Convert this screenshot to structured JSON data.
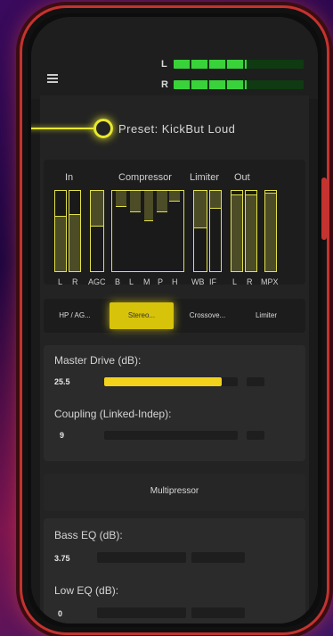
{
  "levels": {
    "left_label": "L",
    "right_label": "R",
    "left_fill": 0.56,
    "right_fill": 0.56
  },
  "preset": {
    "label": "Preset: KickBut  Loud"
  },
  "meters": {
    "group_titles": [
      "In",
      "Compressor",
      "Limiter",
      "Out"
    ],
    "labels": [
      "L",
      "R",
      "AGC",
      "B",
      "L",
      "M",
      "P",
      "H",
      "WB",
      "IF",
      "L",
      "R",
      "MPX"
    ]
  },
  "tabs": [
    {
      "label": "HP / AG..."
    },
    {
      "label": "Stereo..."
    },
    {
      "label": "Crossove..."
    },
    {
      "label": "Limiter"
    }
  ],
  "controls": {
    "master_drive": {
      "label": "Master Drive (dB):",
      "value": "25.5",
      "fill": 0.88
    },
    "coupling": {
      "label": "Coupling (Linked-Indep):",
      "value": "9",
      "fill": 0.0
    }
  },
  "multipressor": {
    "title": "Multipressor",
    "bass_eq": {
      "label": "Bass EQ (dB):",
      "value": "3.75",
      "fill": 0.0
    },
    "low_eq": {
      "label": "Low EQ (dB):",
      "value": "0",
      "fill": 0.0
    }
  },
  "colors": {
    "accent": "#e2e24a",
    "level_green": "#3ad23a",
    "phone_frame": "#c4332f"
  }
}
